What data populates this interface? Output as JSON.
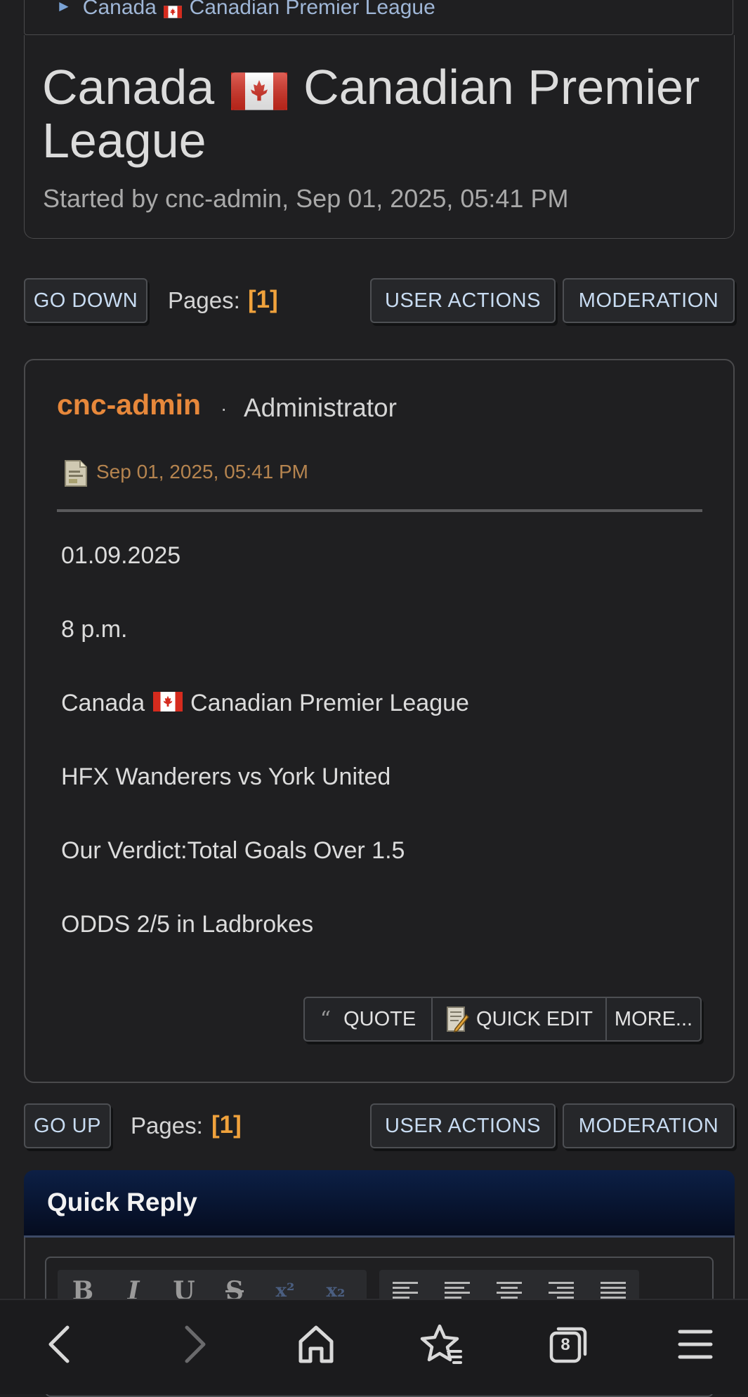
{
  "breadcrumb": {
    "text_before": "Canada",
    "text_after": "Canadian Premier League"
  },
  "topic": {
    "title_before": "Canada",
    "title_after": "Canadian Premier League",
    "started_by": "Started by cnc-admin, Sep 01, 2025, 05:41 PM"
  },
  "nav_top": {
    "go_down": "GO DOWN",
    "pages_label": "Pages:",
    "pages_value": "[1]",
    "user_actions": "USER ACTIONS",
    "moderation": "MODERATION"
  },
  "post": {
    "author": "cnc-admin",
    "separator": "·",
    "role": "Administrator",
    "date": "Sep 01, 2025, 05:41 PM",
    "lines": {
      "date": "01.09.2025",
      "time": "8 p.m.",
      "league_before": "Canada",
      "league_after": "Canadian Premier League",
      "match": "HFX Wanderers vs York United",
      "verdict": "Our Verdict:Total Goals Over 1.5",
      "odds": "ODDS 2/5 in Ladbrokes"
    },
    "actions": {
      "quote": "QUOTE",
      "quick_edit": "QUICK EDIT",
      "more": "MORE..."
    }
  },
  "nav_bottom": {
    "go_up": "GO UP",
    "pages_label": "Pages:",
    "pages_value": "[1]",
    "user_actions": "USER ACTIONS",
    "moderation": "MODERATION"
  },
  "quick_reply": {
    "title": "Quick Reply",
    "toolbar": [
      "B",
      "I",
      "U",
      "S",
      "x²",
      "x₂"
    ],
    "align_icons": [
      "align-left-icon",
      "align-center-icon",
      "align-center-alt-icon",
      "align-right-icon",
      "justify-icon"
    ]
  },
  "browser_bar": {
    "tab_count": "8",
    "icons": [
      "back-icon",
      "forward-icon",
      "home-icon",
      "bookmarks-icon",
      "tabs-icon",
      "menu-icon"
    ]
  },
  "colors": {
    "background": "#1f1f21",
    "username": "#e7883b",
    "pages_number": "#f0a23c",
    "button_text": "#c8dcf2",
    "quick_reply_header": "#0c1f45"
  }
}
